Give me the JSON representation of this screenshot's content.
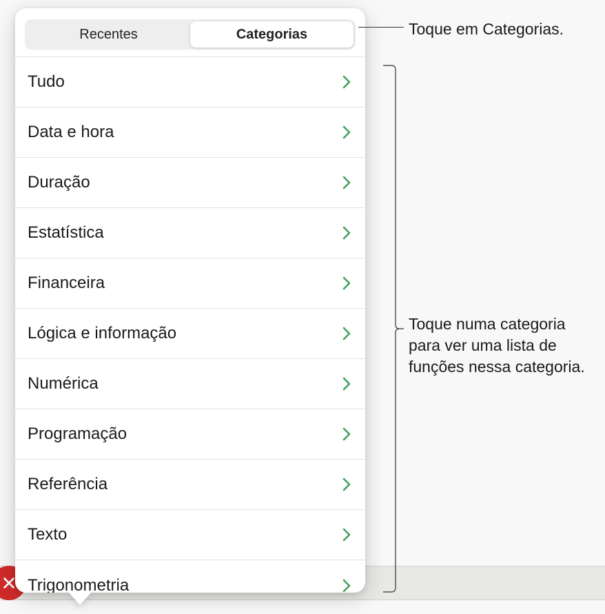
{
  "segmented": {
    "recent": "Recentes",
    "categories": "Categorias",
    "active": "categories"
  },
  "list": {
    "items": [
      {
        "label": "Tudo"
      },
      {
        "label": "Data e hora"
      },
      {
        "label": "Duração"
      },
      {
        "label": "Estatística"
      },
      {
        "label": "Financeira"
      },
      {
        "label": "Lógica e informação"
      },
      {
        "label": "Numérica"
      },
      {
        "label": "Programação"
      },
      {
        "label": "Referência"
      },
      {
        "label": "Texto"
      },
      {
        "label": "Trigonometria"
      }
    ]
  },
  "callouts": {
    "tap_categories": "Toque em Categorias.",
    "tap_category_list": "Toque numa categoria para ver uma lista de funções nessa categoria."
  },
  "colors": {
    "chevron": "#3fa05a",
    "close_bg": "#d12a2a"
  }
}
